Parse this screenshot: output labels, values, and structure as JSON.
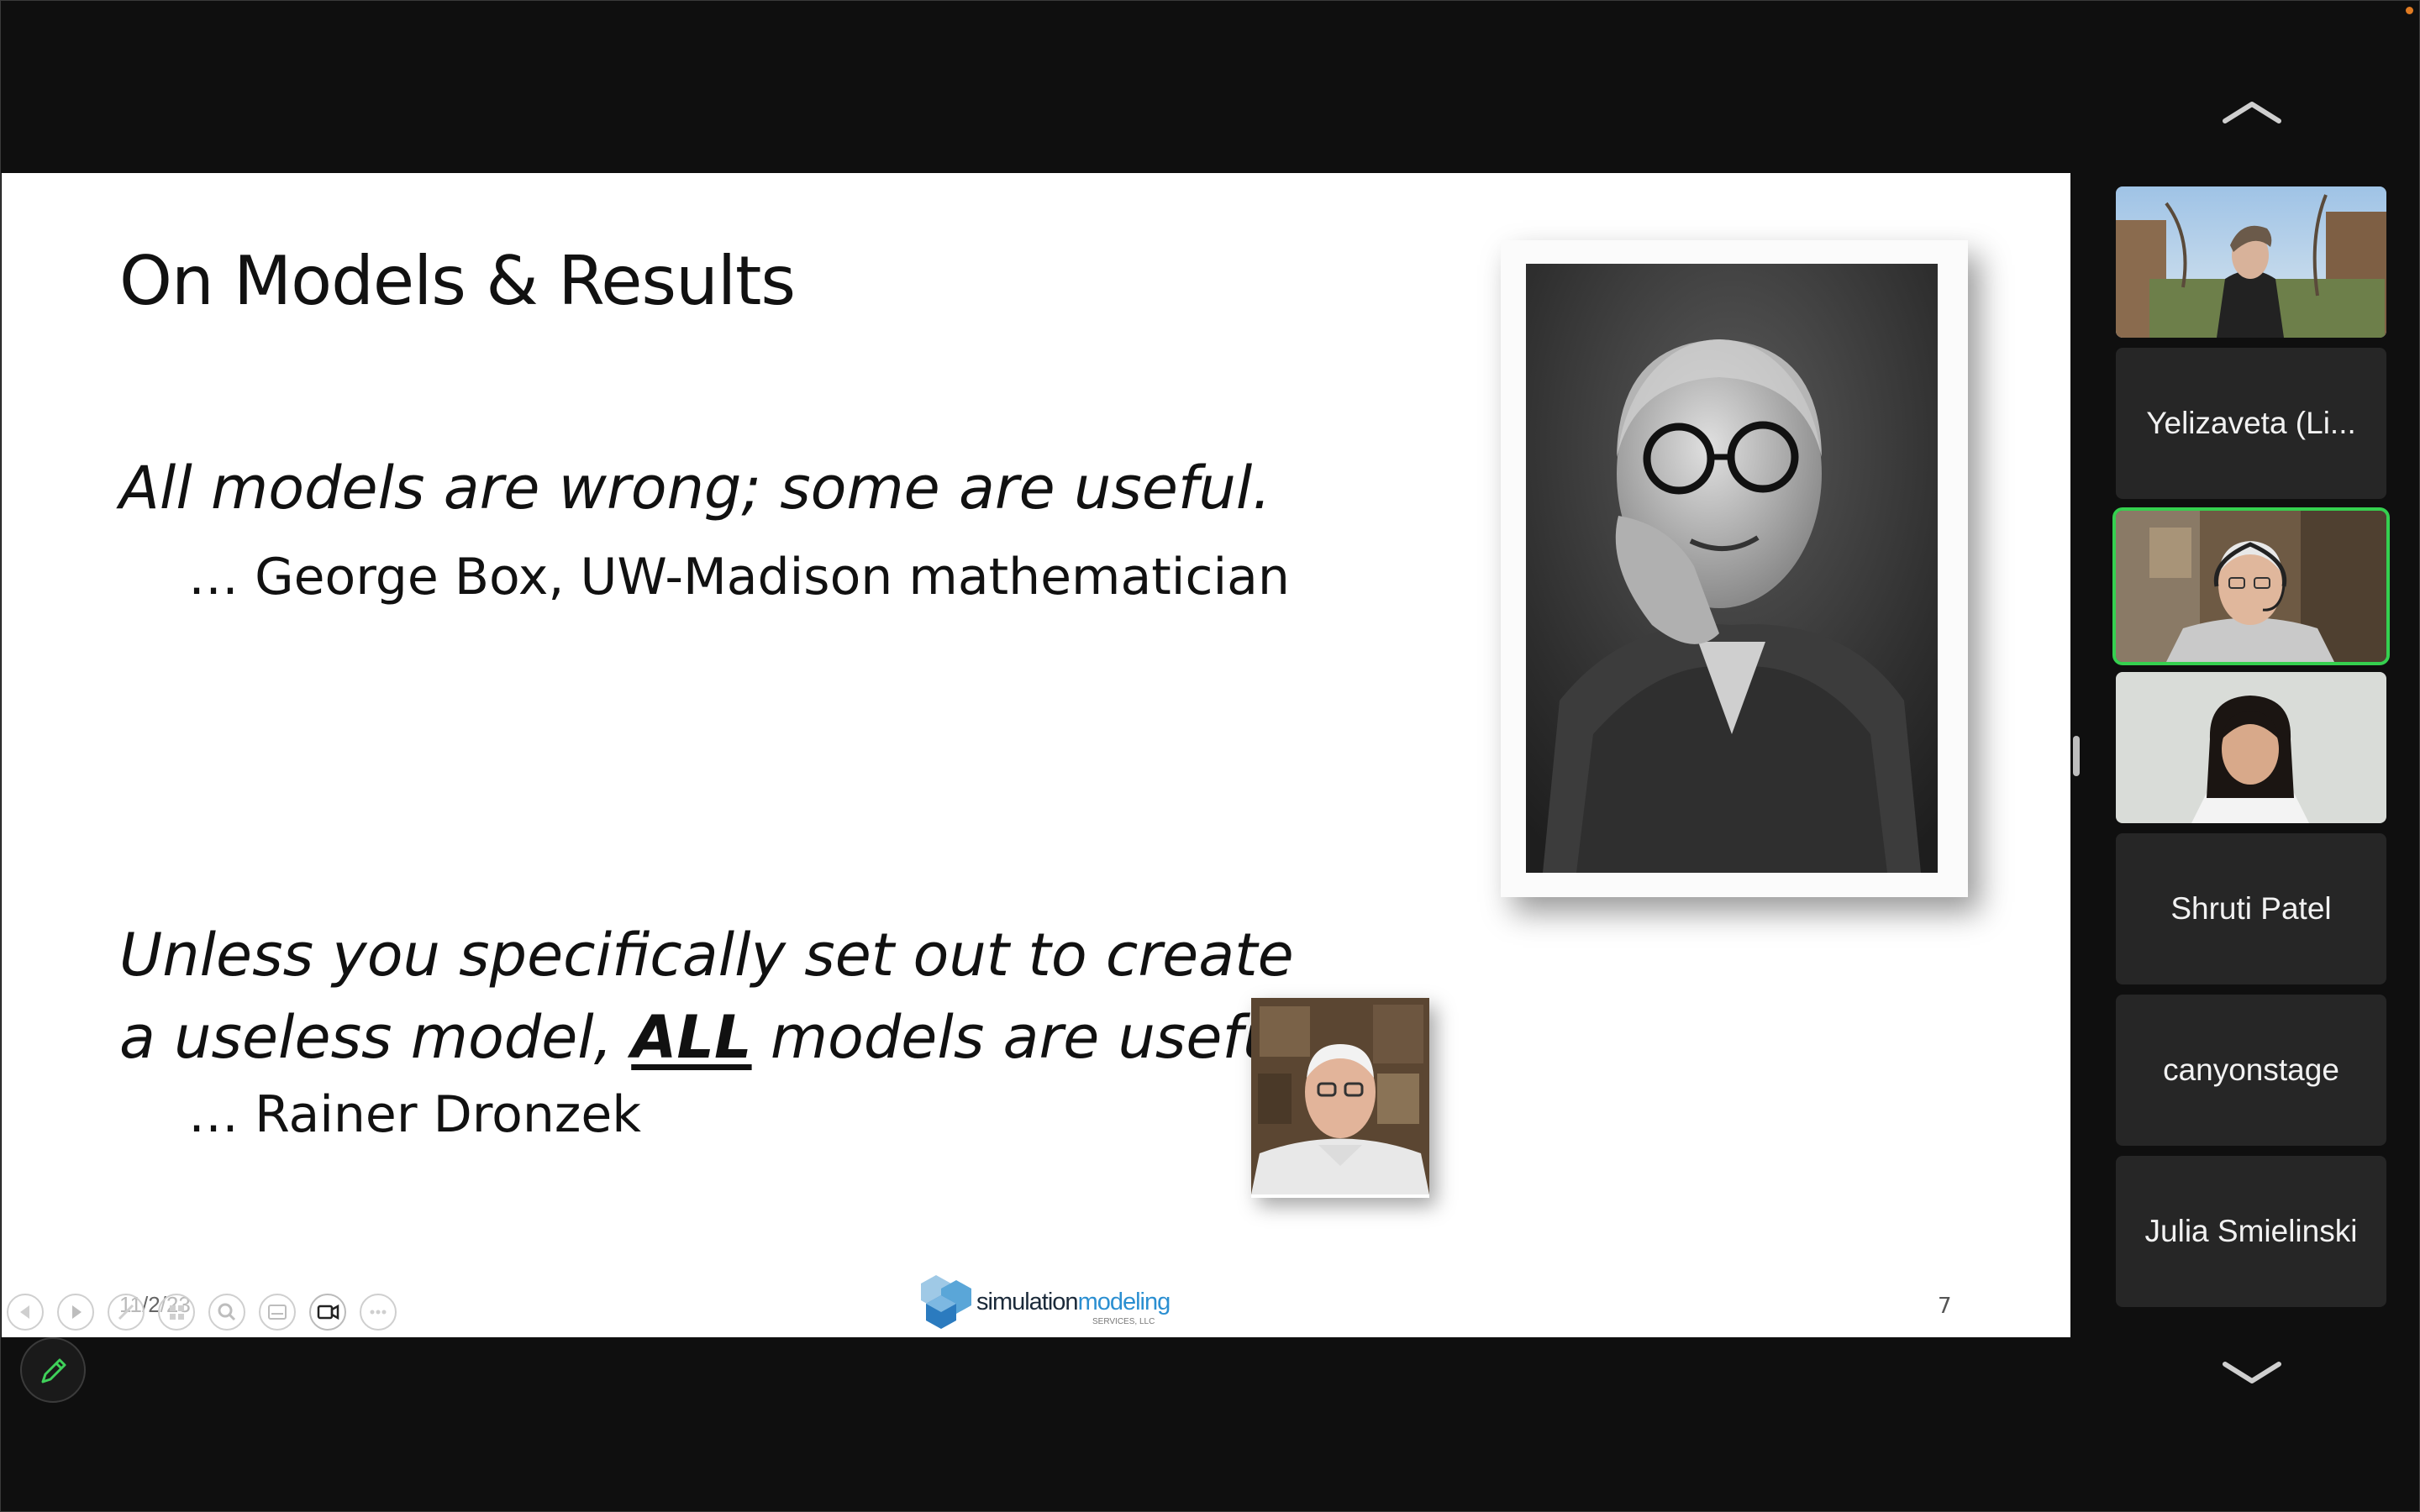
{
  "slide": {
    "title": "On Models & Results",
    "quote1": "All models are wrong; some are useful.",
    "attribution1": "… George Box, UW-Madison mathematician",
    "quote2_line1": "Unless you specifically set out to create",
    "quote2_line2_before": "a useless model, ",
    "quote2_emphasis": "ALL",
    "quote2_line2_after": " models are useful.",
    "attribution2": "… Rainer Dronzek",
    "date": "11/2/23",
    "page_number": "7",
    "logo_text_dark": "simulation",
    "logo_text_blue": "modeling",
    "logo_subtext": "SERVICES, LLC"
  },
  "presentation_controls": [
    {
      "name": "previous-slide-button",
      "icon": "chevron-left-icon"
    },
    {
      "name": "next-slide-button",
      "icon": "chevron-right-icon"
    },
    {
      "name": "pen-tool-button",
      "icon": "pen-icon"
    },
    {
      "name": "slide-overview-button",
      "icon": "grid-icon"
    },
    {
      "name": "zoom-button",
      "icon": "magnifier-icon"
    },
    {
      "name": "subtitles-button",
      "icon": "subtitles-icon"
    },
    {
      "name": "camera-button",
      "icon": "camera-icon"
    },
    {
      "name": "more-options-button",
      "icon": "more-icon"
    }
  ],
  "participants": [
    {
      "name": "",
      "type": "video",
      "speaking": false
    },
    {
      "name": "Yelizaveta (Li...",
      "type": "name",
      "speaking": false
    },
    {
      "name": "",
      "type": "video",
      "speaking": true
    },
    {
      "name": "",
      "type": "video",
      "speaking": false
    },
    {
      "name": "Shruti Patel",
      "type": "name",
      "speaking": false
    },
    {
      "name": "canyonstage",
      "type": "name",
      "speaking": false
    },
    {
      "name": "Julia Smielinski",
      "type": "name",
      "speaking": false
    }
  ],
  "colors": {
    "background": "#0f0f0f",
    "tile": "#262626",
    "active_speaker_border": "#35d04f",
    "logo_blue": "#2b8fd1",
    "recording_dot": "#e07b22"
  }
}
